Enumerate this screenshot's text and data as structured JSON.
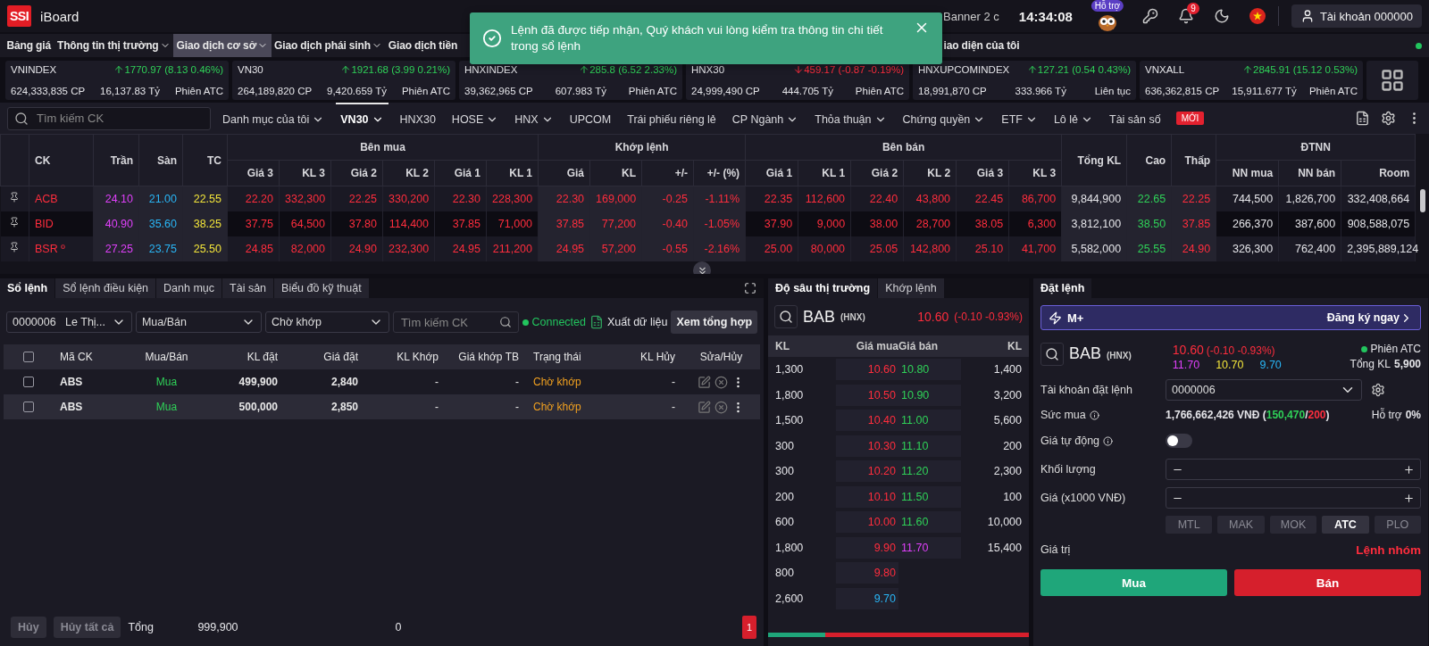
{
  "header": {
    "logo": "SSI",
    "app_name": "iBoard",
    "banner": "Banner 2 c",
    "time": "14:34:08",
    "support_badge": "Hỗ trợ",
    "notifications": "9",
    "account": "Tài khoản 000000"
  },
  "toast": {
    "kind": "success",
    "message": "Lệnh đã được tiếp nhận, Quý khách vui lòng kiểm tra thông tin chi tiết trong sổ lệnh"
  },
  "nav": {
    "items": [
      {
        "label": "Bảng giá",
        "dropdown": false,
        "selected": false
      },
      {
        "label": "Thông tin thị trường",
        "dropdown": true,
        "selected": false
      },
      {
        "label": "Giao dịch cơ sở",
        "dropdown": true,
        "selected": true
      },
      {
        "label": "Giao dịch phái sinh",
        "dropdown": true,
        "selected": false
      },
      {
        "label": "Giao dịch tiền",
        "dropdown": false,
        "selected": false
      }
    ],
    "partial_item": "iao diện của tôi"
  },
  "indices": [
    {
      "name": "VNINDEX",
      "kind": "up",
      "change": "1770.97 (8.13 0.46%)",
      "volume": "624,333,835 CP",
      "value": "16,137.83 Tỷ",
      "session": "Phiên ATC"
    },
    {
      "name": "VN30",
      "kind": "up",
      "change": "1921.68 (3.99 0.21%)",
      "volume": "264,189,820 CP",
      "value": "9,420.659 Tỷ",
      "session": "Phiên ATC"
    },
    {
      "name": "HNXINDEX",
      "kind": "up",
      "change": "285.8 (6.52 2.33%)",
      "volume": "39,362,965 CP",
      "value": "607.983 Tỷ",
      "session": "Phiên ATC"
    },
    {
      "name": "HNX30",
      "kind": "down",
      "change": "459.17 (-0.87 -0.19%)",
      "volume": "24,999,490 CP",
      "value": "444.705 Tỷ",
      "session": "Phiên ATC"
    },
    {
      "name": "HNXUPCOMINDEX",
      "kind": "up",
      "change": "127.21 (0.54 0.43%)",
      "volume": "18,991,870 CP",
      "value": "333.966 Tỷ",
      "session": "Liên tục"
    },
    {
      "name": "VNXALL",
      "kind": "up",
      "change": "2845.91 (15.12 0.53%)",
      "volume": "636,362,815 CP",
      "value": "15,911.677 Tỷ",
      "session": "Phiên ATC"
    }
  ],
  "market": {
    "search": {
      "placeholder": "Tìm kiếm CK"
    },
    "tabs": [
      {
        "label": "Danh mục của tôi",
        "dropdown": true,
        "selected": false
      },
      {
        "label": "VN30",
        "dropdown": true,
        "selected": true
      },
      {
        "label": "HNX30",
        "dropdown": false,
        "selected": false
      },
      {
        "label": "HOSE",
        "dropdown": true,
        "selected": false
      },
      {
        "label": "HNX",
        "dropdown": true,
        "selected": false
      },
      {
        "label": "UPCOM",
        "dropdown": false,
        "selected": false
      },
      {
        "label": "Trái phiếu riêng lẻ",
        "dropdown": false,
        "selected": false
      },
      {
        "label": "CP Ngành",
        "dropdown": true,
        "selected": false
      },
      {
        "label": "Thỏa thuận",
        "dropdown": true,
        "selected": false
      },
      {
        "label": "Chứng quyền",
        "dropdown": true,
        "selected": false
      },
      {
        "label": "ETF",
        "dropdown": true,
        "selected": false
      },
      {
        "label": "Lô lẻ",
        "dropdown": true,
        "selected": false
      },
      {
        "label": "Tài sản số",
        "dropdown": false,
        "selected": false,
        "badge": "MỚI"
      }
    ],
    "header": [
      {
        "label": "CK"
      },
      {
        "label": "Trần"
      },
      {
        "label": "Sàn"
      },
      {
        "label": "TC"
      },
      {
        "label": "Bên mua",
        "columns": [
          "Giá 3",
          "KL 3",
          "Giá 2",
          "KL 2",
          "Giá 1",
          "KL 1"
        ]
      },
      {
        "label": "Khớp lệnh",
        "columns": [
          "Giá",
          "KL",
          "+/-",
          "+/- (%)"
        ]
      },
      {
        "label": "Bên bán",
        "columns": [
          "Giá 1",
          "KL 1",
          "Giá 2",
          "KL 2",
          "Giá 3",
          "KL 3"
        ]
      },
      {
        "label": "Tổng KL"
      },
      {
        "label": "Cao"
      },
      {
        "label": "Thấp"
      },
      {
        "label": "ĐTNN",
        "columns": [
          "NN mua",
          "NN bán",
          "Room"
        ]
      }
    ],
    "rows": [
      {
        "symbol": "ACB",
        "color": "#ff2d3d",
        "cells": [
          {
            "text": "24.10",
            "color": "#e040fb"
          },
          {
            "text": "21.00",
            "color": "#29b6f6"
          },
          {
            "text": "22.55",
            "color": "#f2e43a"
          },
          {
            "text": "22.20",
            "color": "#ff2d3d"
          },
          {
            "text": "332,300",
            "color": "#ff2d3d"
          },
          {
            "text": "22.25",
            "color": "#ff2d3d"
          },
          {
            "text": "330,200",
            "color": "#ff2d3d"
          },
          {
            "text": "22.30",
            "color": "#ff2d3d"
          },
          {
            "text": "228,300",
            "color": "#ff2d3d"
          },
          {
            "text": "22.30",
            "color": "#ff2d3d"
          },
          {
            "text": "169,000",
            "color": "#ff2d3d"
          },
          {
            "text": "-0.25",
            "color": "#ff2d3d"
          },
          {
            "text": "-1.11%",
            "color": "#ff2d3d"
          },
          {
            "text": "22.35",
            "color": "#ff2d3d"
          },
          {
            "text": "112,600",
            "color": "#ff2d3d"
          },
          {
            "text": "22.40",
            "color": "#ff2d3d"
          },
          {
            "text": "43,800",
            "color": "#ff2d3d"
          },
          {
            "text": "22.45",
            "color": "#ff2d3d"
          },
          {
            "text": "86,700",
            "color": "#ff2d3d"
          },
          {
            "text": "9,844,900",
            "color": "#e4e4e8"
          },
          {
            "text": "22.65",
            "color": "#2fd158"
          },
          {
            "text": "22.25",
            "color": "#ff2d3d"
          },
          {
            "text": "744,500",
            "color": "#e4e4e8"
          },
          {
            "text": "1,826,700",
            "color": "#e4e4e8"
          },
          {
            "text": "332,408,664",
            "color": "#e4e4e8"
          }
        ]
      },
      {
        "symbol": "BID",
        "color": "#ff2d3d",
        "cells": [
          {
            "text": "40.90",
            "color": "#e040fb"
          },
          {
            "text": "35.60",
            "color": "#29b6f6"
          },
          {
            "text": "38.25",
            "color": "#f2e43a"
          },
          {
            "text": "37.75",
            "color": "#ff2d3d"
          },
          {
            "text": "64,500",
            "color": "#ff2d3d"
          },
          {
            "text": "37.80",
            "color": "#ff2d3d"
          },
          {
            "text": "114,400",
            "color": "#ff2d3d"
          },
          {
            "text": "37.85",
            "color": "#ff2d3d"
          },
          {
            "text": "71,000",
            "color": "#ff2d3d"
          },
          {
            "text": "37.85",
            "color": "#ff2d3d"
          },
          {
            "text": "77,200",
            "color": "#ff2d3d"
          },
          {
            "text": "-0.40",
            "color": "#ff2d3d"
          },
          {
            "text": "-1.05%",
            "color": "#ff2d3d"
          },
          {
            "text": "37.90",
            "color": "#ff2d3d"
          },
          {
            "text": "9,000",
            "color": "#ff2d3d"
          },
          {
            "text": "38.00",
            "color": "#ff2d3d"
          },
          {
            "text": "28,700",
            "color": "#ff2d3d"
          },
          {
            "text": "38.05",
            "color": "#ff2d3d"
          },
          {
            "text": "6,300",
            "color": "#ff2d3d"
          },
          {
            "text": "3,812,100",
            "color": "#e4e4e8"
          },
          {
            "text": "38.50",
            "color": "#2fd158"
          },
          {
            "text": "37.85",
            "color": "#ff2d3d"
          },
          {
            "text": "266,370",
            "color": "#e4e4e8"
          },
          {
            "text": "387,600",
            "color": "#e4e4e8"
          },
          {
            "text": "908,588,075",
            "color": "#e4e4e8"
          }
        ]
      },
      {
        "symbol": "BSR º",
        "color": "#ff2d3d",
        "cells": [
          {
            "text": "27.25",
            "color": "#e040fb"
          },
          {
            "text": "23.75",
            "color": "#29b6f6"
          },
          {
            "text": "25.50",
            "color": "#f2e43a"
          },
          {
            "text": "24.85",
            "color": "#ff2d3d"
          },
          {
            "text": "82,000",
            "color": "#ff2d3d"
          },
          {
            "text": "24.90",
            "color": "#ff2d3d"
          },
          {
            "text": "232,300",
            "color": "#ff2d3d"
          },
          {
            "text": "24.95",
            "color": "#ff2d3d"
          },
          {
            "text": "211,200",
            "color": "#ff2d3d"
          },
          {
            "text": "24.95",
            "color": "#ff2d3d"
          },
          {
            "text": "57,200",
            "color": "#ff2d3d"
          },
          {
            "text": "-0.55",
            "color": "#ff2d3d"
          },
          {
            "text": "-2.16%",
            "color": "#ff2d3d"
          },
          {
            "text": "25.00",
            "color": "#ff2d3d"
          },
          {
            "text": "80,000",
            "color": "#ff2d3d"
          },
          {
            "text": "25.05",
            "color": "#ff2d3d"
          },
          {
            "text": "142,800",
            "color": "#ff2d3d"
          },
          {
            "text": "25.10",
            "color": "#ff2d3d"
          },
          {
            "text": "41,700",
            "color": "#ff2d3d"
          },
          {
            "text": "5,582,000",
            "color": "#e4e4e8"
          },
          {
            "text": "25.55",
            "color": "#2fd158"
          },
          {
            "text": "24.90",
            "color": "#ff2d3d"
          },
          {
            "text": "326,300",
            "color": "#e4e4e8"
          },
          {
            "text": "762,400",
            "color": "#e4e4e8"
          },
          {
            "text": "2,395,889,124",
            "color": "#e4e4e8"
          }
        ]
      }
    ]
  },
  "orders": {
    "tabs": [
      {
        "label": "Sổ lệnh",
        "selected": true
      },
      {
        "label": "Sổ lệnh điều kiện",
        "selected": false
      },
      {
        "label": "Danh mục",
        "selected": false
      },
      {
        "label": "Tài sản",
        "selected": false
      },
      {
        "label": "Biểu đồ kỹ thuật",
        "selected": false
      }
    ],
    "account_select": {
      "account": "0000006",
      "name": "Le Thị..."
    },
    "side_select": "Mua/Bán",
    "status_select": "Chờ khớp",
    "search": {
      "placeholder": "Tìm kiếm CK"
    },
    "connection": "Connected",
    "export": "Xuất dữ liệu",
    "summary_button": "Xem tổng hợp",
    "select_all": {
      "checked": false
    },
    "columns": [
      "Mã CK",
      "Mua/Bán",
      "KL đặt",
      "Giá đặt",
      "KL Khớp",
      "Giá khớp TB",
      "Trạng thái",
      "KL Hủy",
      "Sửa/Hủy"
    ],
    "rows": [
      {
        "checked": false,
        "symbol": "ABS",
        "side": "Mua",
        "color": "#2fd158",
        "qty": "499,900",
        "price": "2,840",
        "matched_qty": "-",
        "avg_price": "-",
        "status": "Chờ khớp",
        "cancelled_qty": "-",
        "selected": false
      },
      {
        "checked": false,
        "symbol": "ABS",
        "side": "Mua",
        "color": "#2fd158",
        "qty": "500,000",
        "price": "2,850",
        "matched_qty": "-",
        "avg_price": "-",
        "status": "Chờ khớp",
        "cancelled_qty": "-",
        "selected": true
      }
    ],
    "footer": {
      "cancel": "Hủy",
      "cancel_all": "Hủy tất cả",
      "total_label": "Tổng",
      "total_qty": "999,900",
      "total_matched": "0",
      "page": "1"
    }
  },
  "depth": {
    "tabs": [
      {
        "label": "Độ sâu thị trường",
        "selected": true
      },
      {
        "label": "Khớp lệnh",
        "selected": false
      }
    ],
    "symbol": "BAB",
    "exchange": "(HNX)",
    "price": "10.60",
    "change": "(-0.10 -0.93%)",
    "color": "#ff2d3d",
    "columns": [
      "KL",
      "Giá mua",
      "Giá bán",
      "KL"
    ],
    "rows": [
      {
        "bid_qty": "1,300",
        "bid": {
          "price": "10.60",
          "color": "#ff2d3d"
        },
        "ask": {
          "price": "10.80",
          "color": "#2fd158"
        },
        "ask_qty": "1,400"
      },
      {
        "bid_qty": "1,800",
        "bid": {
          "price": "10.50",
          "color": "#ff2d3d"
        },
        "ask": {
          "price": "10.90",
          "color": "#2fd158"
        },
        "ask_qty": "3,200"
      },
      {
        "bid_qty": "1,500",
        "bid": {
          "price": "10.40",
          "color": "#ff2d3d"
        },
        "ask": {
          "price": "11.00",
          "color": "#2fd158"
        },
        "ask_qty": "5,600"
      },
      {
        "bid_qty": "300",
        "bid": {
          "price": "10.30",
          "color": "#ff2d3d"
        },
        "ask": {
          "price": "11.10",
          "color": "#2fd158"
        },
        "ask_qty": "200"
      },
      {
        "bid_qty": "300",
        "bid": {
          "price": "10.20",
          "color": "#ff2d3d"
        },
        "ask": {
          "price": "11.20",
          "color": "#2fd158"
        },
        "ask_qty": "2,300"
      },
      {
        "bid_qty": "200",
        "bid": {
          "price": "10.10",
          "color": "#ff2d3d"
        },
        "ask": {
          "price": "11.50",
          "color": "#2fd158"
        },
        "ask_qty": "100"
      },
      {
        "bid_qty": "600",
        "bid": {
          "price": "10.00",
          "color": "#ff2d3d"
        },
        "ask": {
          "price": "11.60",
          "color": "#2fd158"
        },
        "ask_qty": "10,000"
      },
      {
        "bid_qty": "1,800",
        "bid": {
          "price": "9.90",
          "color": "#ff2d3d"
        },
        "ask": {
          "price": "11.70",
          "color": "#e040fb"
        },
        "ask_qty": "15,400"
      },
      {
        "bid_qty": "800",
        "bid": {
          "price": "9.80",
          "color": "#ff2d3d"
        }
      },
      {
        "bid_qty": "2,600",
        "bid": {
          "price": "9.70",
          "color": "#29b6f6"
        }
      }
    ],
    "balance": {
      "level": 0.22
    }
  },
  "order_form": {
    "tabs": [
      {
        "label": "Đặt lệnh",
        "selected": true
      }
    ],
    "promo": {
      "title": "M+",
      "action": "Đăng ký ngay"
    },
    "symbol": "BAB",
    "exchange": "(HNX)",
    "price": "10.60",
    "change": "(-0.10 -0.93%)",
    "color": "#ff2d3d",
    "ceiling": "11.70",
    "reference": "10.70",
    "floor": "9.70",
    "session": "Phiên ATC",
    "total_label": "Tổng KL",
    "total": "5,900",
    "account": {
      "label": "Tài khoản đặt lệnh",
      "value": "0000006"
    },
    "buying_power": {
      "label": "Sức mua",
      "parts": [
        {
          "text": "1,766,662,426 VNĐ (",
          "color": "#e4e4e8"
        },
        {
          "text": "150,470",
          "color": "#2fd158"
        },
        {
          "text": "/",
          "color": "#e4e4e8"
        },
        {
          "text": "200",
          "color": "#ff2d3d"
        },
        {
          "text": ")",
          "color": "#e4e4e8"
        }
      ],
      "support_label": "Hỗ trợ",
      "support": "0%"
    },
    "auto_price": {
      "label": "Giá tự động",
      "on": false
    },
    "quantity_label": "Khối lượng",
    "price_label": "Giá (x1000 VNĐ)",
    "order_types": [
      {
        "label": "MTL",
        "selected": false
      },
      {
        "label": "MAK",
        "selected": false
      },
      {
        "label": "MOK",
        "selected": false
      },
      {
        "label": "ATC",
        "selected": true
      },
      {
        "label": "PLO",
        "selected": false
      }
    ],
    "value_label": "Giá trị",
    "group_order": "Lệnh nhóm",
    "buy": "Mua",
    "sell": "Bán"
  }
}
